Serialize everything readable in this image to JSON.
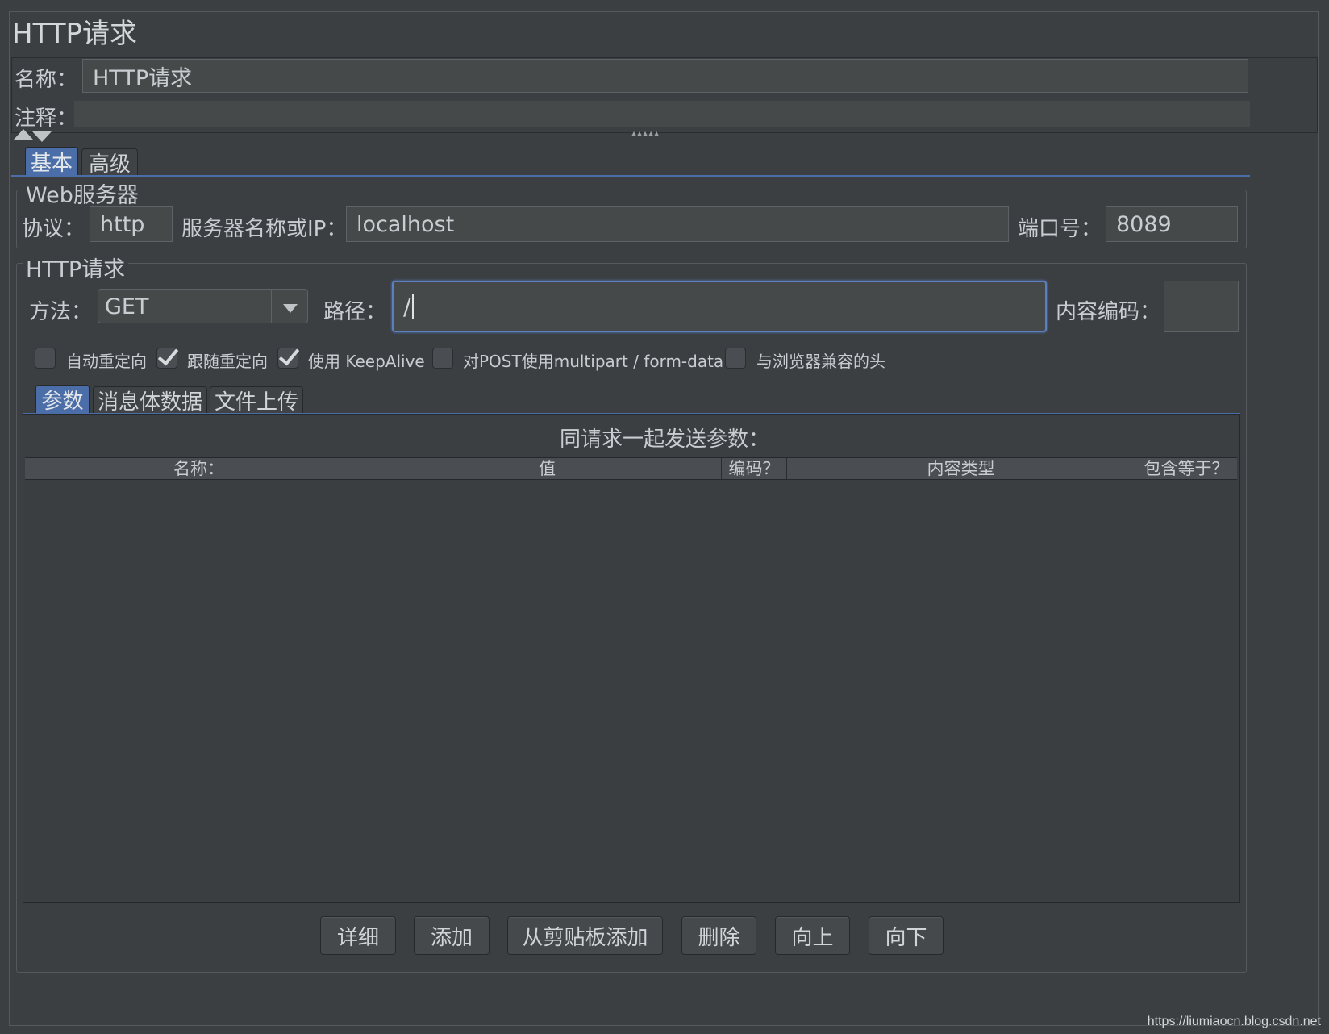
{
  "title": "HTTP请求",
  "name_label": "名称：",
  "name_value": "HTTP请求",
  "comment_label": "注释：",
  "comment_value": "",
  "main_tabs": [
    {
      "label": "基本",
      "active": true
    },
    {
      "label": "高级",
      "active": false
    }
  ],
  "web_server": {
    "group_title": "Web服务器",
    "protocol_label": "协议：",
    "protocol_value": "http",
    "server_label": "服务器名称或IP：",
    "server_value": "localhost",
    "port_label": "端口号：",
    "port_value": "8089"
  },
  "http_request": {
    "group_title": "HTTP请求",
    "method_label": "方法：",
    "method_value": "GET",
    "path_label": "路径：",
    "path_value": "/",
    "encoding_label": "内容编码：",
    "encoding_value": ""
  },
  "options": [
    {
      "label": "自动重定向",
      "checked": false
    },
    {
      "label": "跟随重定向",
      "checked": true
    },
    {
      "label": "使用 KeepAlive",
      "checked": true
    },
    {
      "label": "对POST使用multipart / form-data",
      "checked": false
    },
    {
      "label": "与浏览器兼容的头",
      "checked": false
    }
  ],
  "sub_tabs": [
    {
      "label": "参数",
      "active": true
    },
    {
      "label": "消息体数据",
      "active": false
    },
    {
      "label": "文件上传",
      "active": false
    }
  ],
  "params": {
    "caption": "同请求一起发送参数：",
    "columns": [
      "名称：",
      "值",
      "编码？",
      "内容类型",
      "包含等于？"
    ],
    "rows": []
  },
  "buttons": {
    "detail": "详细",
    "add": "添加",
    "add_clipboard": "从剪贴板添加",
    "delete": "删除",
    "up": "向上",
    "down": "向下"
  },
  "watermark": "https://liumiaocn.blog.csdn.net",
  "colors": {
    "background": "#3b3f42",
    "accent": "#4b6ea9",
    "focus_border": "#5b7fc0"
  }
}
